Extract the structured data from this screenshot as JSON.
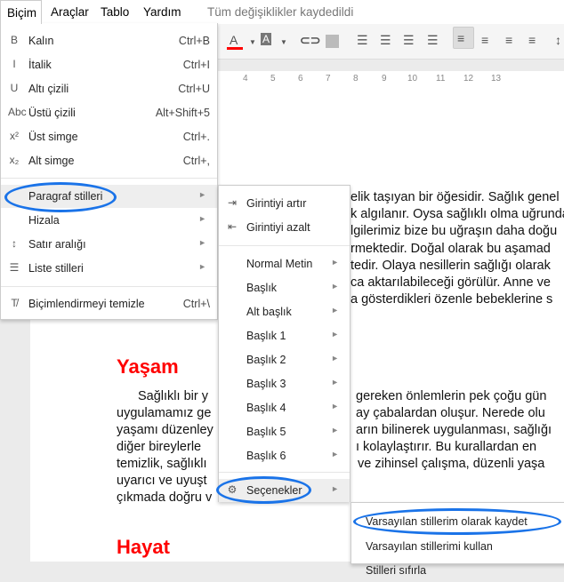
{
  "menubar": {
    "items": [
      "Biçim",
      "Araçlar",
      "Tablo",
      "Yardım"
    ],
    "status": "Tüm değişiklikler kaydedildi"
  },
  "ruler": [
    "4",
    "5",
    "6",
    "7",
    "8",
    "9",
    "10",
    "11",
    "12",
    "13"
  ],
  "document": {
    "para1": [
      "elik taşıyan bir öğesidir. Sağlık genel",
      "k algılanır. Oysa sağlıklı olma uğrunda",
      "lgilerimiz bize bu uğraşın daha doğu",
      "rmektedir. Doğal olarak bu aşamad",
      "tedir. Olaya nesillerin sağlığı olarak",
      "ca aktarılabileceği görülür. Anne ve",
      "a gösterdikleri özenle bebeklerine s"
    ],
    "heading1": "Yaşam",
    "para2_left": [
      "Sağlıklı bir y",
      "uygulamamız ge",
      "yaşamı düzenley",
      "diğer bireylerle",
      "temizlik, sağlıklı",
      "uyarıcı ve uyuşt",
      "çıkmada doğru v"
    ],
    "para2_right": [
      "gereken önlemlerin pek çoğu gün",
      "ay çabalardan oluşur. Nerede olu",
      "arın bilinerek uygulanması, sağlığı",
      "ı kolaylaştırır. Bu kurallardan en",
      "ve zihinsel çalışma, düzenli yaşa",
      "",
      ""
    ],
    "heading2": "Hayat"
  },
  "format_menu": {
    "items": [
      {
        "icon": "bold-icon",
        "glyph": "B",
        "label": "Kalın",
        "shortcut": "Ctrl+B"
      },
      {
        "icon": "italic-icon",
        "glyph": "I",
        "label": "İtalik",
        "shortcut": "Ctrl+I"
      },
      {
        "icon": "underline-icon",
        "glyph": "U",
        "label": "Altı çizili",
        "shortcut": "Ctrl+U"
      },
      {
        "icon": "strikethrough-icon",
        "glyph": "Abc",
        "label": "Üstü çizili",
        "shortcut": "Alt+Shift+5"
      },
      {
        "icon": "superscript-icon",
        "glyph": "x²",
        "label": "Üst simge",
        "shortcut": "Ctrl+."
      },
      {
        "icon": "subscript-icon",
        "glyph": "x₂",
        "label": "Alt simge",
        "shortcut": "Ctrl+,"
      },
      {
        "icon": "",
        "glyph": "",
        "label": "Paragraf stilleri",
        "shortcut": "►"
      },
      {
        "icon": "",
        "glyph": "",
        "label": "Hizala",
        "shortcut": "►"
      },
      {
        "icon": "line-spacing-icon",
        "glyph": "↕",
        "label": "Satır aralığı",
        "shortcut": "►"
      },
      {
        "icon": "list-icon",
        "glyph": "☰",
        "label": "Liste stilleri",
        "shortcut": "►"
      },
      {
        "icon": "clear-format-icon",
        "glyph": "T̸",
        "label": "Biçimlendirmeyi temizle",
        "shortcut": "Ctrl+\\"
      }
    ]
  },
  "paragraph_menu": {
    "items": [
      {
        "label": "Girintiyi artır",
        "glyph": "⇥"
      },
      {
        "label": "Girintiyi azalt",
        "glyph": "⇤"
      },
      {
        "label": "Normal Metin"
      },
      {
        "label": "Başlık"
      },
      {
        "label": "Alt başlık"
      },
      {
        "label": "Başlık 1"
      },
      {
        "label": "Başlık 2"
      },
      {
        "label": "Başlık 3"
      },
      {
        "label": "Başlık 4"
      },
      {
        "label": "Başlık 5"
      },
      {
        "label": "Başlık 6"
      },
      {
        "label": "Seçenekler",
        "glyph": "⚙"
      }
    ]
  },
  "options_menu": {
    "items": [
      "Varsayılan stillerim olarak kaydet",
      "Varsayılan stillerimi kullan",
      "Stilleri sıfırla"
    ]
  },
  "colors": {
    "highlight": "#1a73e8",
    "heading": "#ff0000",
    "text_color_bar": "#ff0000"
  }
}
